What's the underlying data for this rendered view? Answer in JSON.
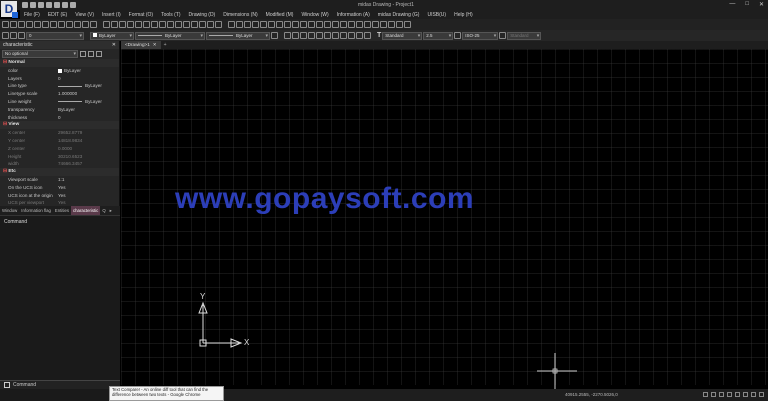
{
  "window": {
    "title": "midas Drawing - Project1",
    "minimize": "—",
    "maximize": "□",
    "close": "✕"
  },
  "menu": [
    "File (F)",
    "EDIT (E)",
    "View (V)",
    "Insert (I)",
    "Format (O)",
    "Tools (T)",
    "Drawing (D)",
    "Dimensions (N)",
    "Modified (M)",
    "Window (W)",
    "Information (A)",
    "midas Drawing (G)",
    "UISB(U)",
    "Help (H)"
  ],
  "menu_right": [
    "Drawing creation (G)",
    "USB(U)",
    "Help (H)"
  ],
  "toolbar2": {
    "layer": "0",
    "color": "ByLayer",
    "linetype": "ByLayer",
    "lineweight": "ByLayer",
    "plotstyle": "ByLayer",
    "textstyle": "Standard",
    "textheight": "2.5",
    "dimstyle": "ISO-25",
    "tablestyle": "Standard"
  },
  "panel": {
    "title": "characteristic",
    "close": "✕",
    "selection": "No optional",
    "sections": {
      "normal": "Normal",
      "view": "View",
      "etc": "Etc"
    },
    "normal": [
      {
        "k": "color",
        "v": "ByLayer"
      },
      {
        "k": "Layers",
        "v": "0"
      },
      {
        "k": "Line type",
        "v": "ByLayer"
      },
      {
        "k": "Linetype scale",
        "v": "1.000000"
      },
      {
        "k": "Line weight",
        "v": "ByLayer"
      },
      {
        "k": "transparency",
        "v": "ByLayer"
      },
      {
        "k": "thickness",
        "v": "0"
      }
    ],
    "view": [
      {
        "k": "X center",
        "v": "29652.8779"
      },
      {
        "k": "Y center",
        "v": "14818.9834"
      },
      {
        "k": "Z center",
        "v": "0.0000"
      },
      {
        "k": "Height",
        "v": "30210.6523"
      },
      {
        "k": "width",
        "v": "74666.3457"
      }
    ],
    "etc": [
      {
        "k": "Viewport scale",
        "v": "1:1"
      },
      {
        "k": "On the UCS icon",
        "v": "Yes"
      },
      {
        "k": "UCS icon at the origin",
        "v": "Yes"
      },
      {
        "k": "UCS per viewport",
        "v": "Yes"
      }
    ],
    "tabs": [
      "Window",
      "Information flag",
      "Entities",
      "characteristic",
      "Q",
      "▸"
    ]
  },
  "command": {
    "label": "Command",
    "input_label": "Command"
  },
  "document_tab": {
    "name": "<Drawing>1",
    "close": "✕",
    "add": "+"
  },
  "watermark": "www.gopaysoft.com",
  "ucs": {
    "x": "X",
    "y": "Y"
  },
  "status": {
    "coords": "40915.2555, -2270.5026,0"
  },
  "tooltip": "Text Compare! - An online diff tool that can find the difference between two texts - Google Chrome"
}
